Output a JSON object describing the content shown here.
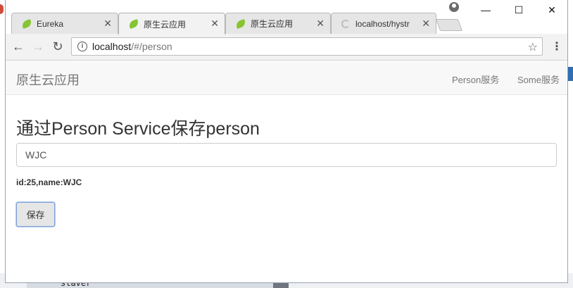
{
  "browser": {
    "tabs": [
      {
        "title": "Eureka",
        "favicon": "spring-leaf-icon",
        "active": false
      },
      {
        "title": "原生云应用",
        "favicon": "spring-leaf-icon",
        "active": true
      },
      {
        "title": "原生云应用",
        "favicon": "spring-leaf-icon",
        "active": false
      },
      {
        "title": "localhost/hystr",
        "favicon": "loading-spinner-icon",
        "active": false
      }
    ],
    "close_glyph": "✕",
    "window_controls": {
      "minimize": "—",
      "maximize": "☐",
      "close": "✕"
    },
    "nav": {
      "back": "←",
      "forward": "→",
      "reload": "↻"
    },
    "url": {
      "host": "localhost",
      "path": "/#/person"
    },
    "star_glyph": "☆",
    "menu_glyph": "⋮"
  },
  "navbar": {
    "brand": "原生云应用",
    "links": [
      "Person服务",
      "Some服务"
    ]
  },
  "form": {
    "title": "通过Person Service保存person",
    "name_value": "WJC",
    "result_text": "id:25,name:WJC",
    "save_label": "保存"
  },
  "background": {
    "text": "slaver"
  },
  "colors": {
    "accent_button_border": "#7ea1d6",
    "leaf_green": "#86c433",
    "navbar_bg": "#f8f8f8"
  }
}
